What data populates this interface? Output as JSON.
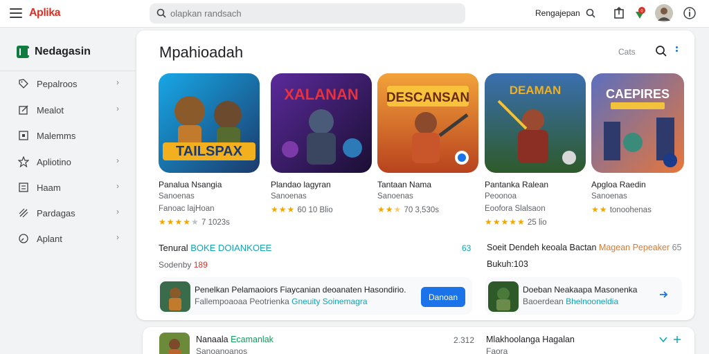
{
  "header": {
    "logo": "Aplika",
    "search_placeholder": "olapkan randsach",
    "top_label": "Rengajepan"
  },
  "sidebar": {
    "brand": "Nedagasin",
    "items": [
      {
        "label": "Pepalroos",
        "icon": "tag-icon"
      },
      {
        "label": "Mealot",
        "icon": "edit-icon"
      },
      {
        "label": "Malemms",
        "icon": "square-icon"
      },
      {
        "label": "Apliotino",
        "icon": "star-icon"
      },
      {
        "label": "Haam",
        "icon": "grid-icon"
      },
      {
        "label": "Pardagas",
        "icon": "pencil-icon"
      },
      {
        "label": "Aplant",
        "icon": "clock-icon"
      }
    ]
  },
  "main": {
    "title": "Mpahioadah",
    "cats_link": "Cats",
    "apps": [
      {
        "name": "Panalua Nsangia",
        "sub": "Sanoenas",
        "sub2": "Fanoac lajHoan",
        "stars": 4.5,
        "rating_text": "7 1023s",
        "icon_title": "TAILSPAX",
        "colors": [
          "#1d6fb8",
          "#f2b01e"
        ]
      },
      {
        "name": "Plandao lagyran",
        "sub": "Sanoenas",
        "rating_text": "60 10 Blio",
        "stars": 3,
        "icon_title": "XALANAN",
        "colors": [
          "#3b1c6b",
          "#d4204a"
        ]
      },
      {
        "name": "Tantaan Nama",
        "sub": "Sanoenas",
        "rating_text": "70 3,530s",
        "stars": 2.5,
        "icon_title": "DESCANSAN",
        "colors": [
          "#e0672a",
          "#f9c23c"
        ]
      },
      {
        "name": "Pantanka Ralean",
        "sub": "Peoonoa",
        "sub2": "Eoofora Slalsaon",
        "stars": 5,
        "rating_text": "25 lio",
        "icon_title": "DEAMAN",
        "colors": [
          "#2e5a8c",
          "#c8443a"
        ]
      },
      {
        "name": "Apgloa Raedin",
        "sub": "Sanoenas",
        "rating_text": "tonoohenas",
        "stars": 2,
        "icon_title": "CAEPIRES",
        "colors": [
          "#38508c",
          "#e8763a"
        ]
      }
    ],
    "row2": {
      "left_text": "Tenural",
      "left_highlight": "BOKE DOIANKOEE",
      "left_count": "63",
      "left_sub_text": "Sodenby",
      "left_sub_highlight": "189",
      "right_text": "Soeit Dendeh keoala Bactan",
      "right_highlight": "Magean Pepeaker",
      "right_count": "65",
      "right_sub": "Bukuh:103"
    },
    "promo_left": {
      "line1": "Penelkan Pelamaoiors Fiaycanian deoanaten Hasondirio.",
      "line2": "Fallempoaoaa Peotrienka",
      "line2_highlight": "Gneuity Soinemagra",
      "button": "Danoan"
    },
    "promo_right": {
      "line1": "Doeban Neakaapa Masonenka",
      "line2": "Baoerdean",
      "line2_highlight": "Bhelnooneldia"
    }
  },
  "bottom": {
    "title": "Nanaala",
    "title_highlight": "Ecamanlak",
    "sub": "Sanoanoanos",
    "count": "2.312",
    "right_title": "Mlakhoolanga Hagalan",
    "right_sub": "Faora"
  }
}
